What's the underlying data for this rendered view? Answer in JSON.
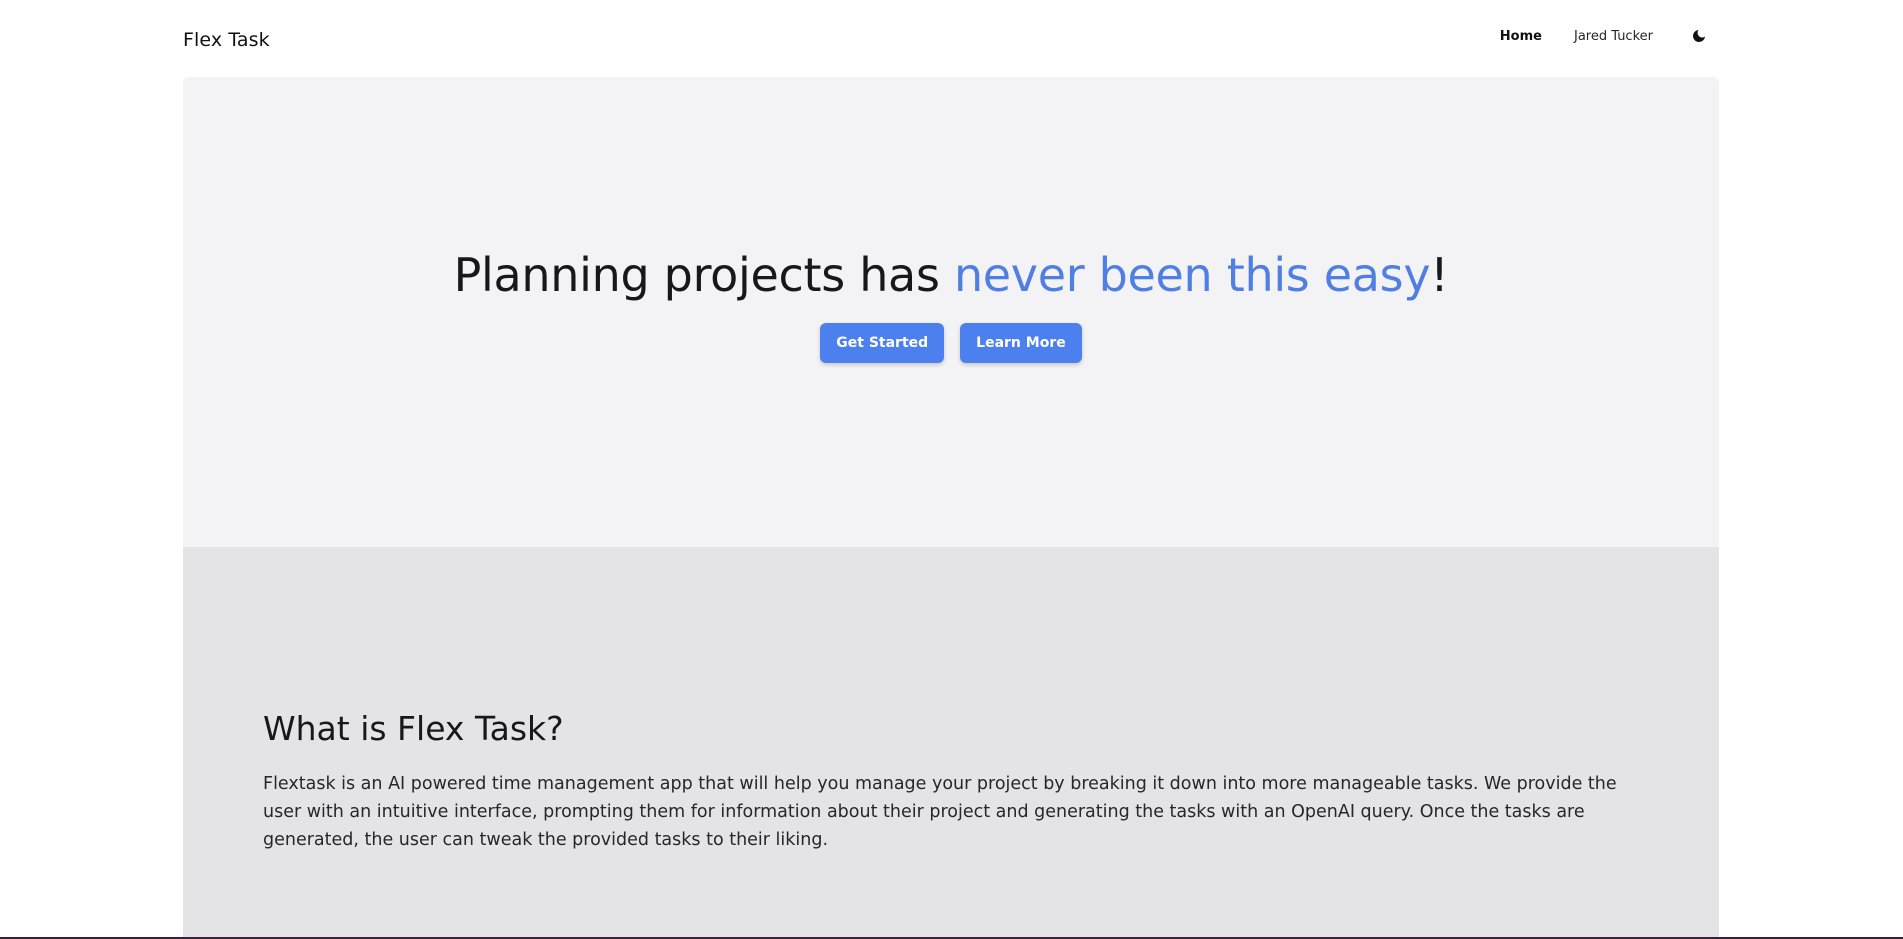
{
  "header": {
    "brand": "Flex Task",
    "nav": {
      "home": "Home",
      "user": "Jared Tucker"
    },
    "theme_icon": "moon-icon"
  },
  "hero": {
    "title_prefix": "Planning projects has ",
    "title_accent": "never been this easy",
    "title_suffix": "!",
    "primary_button": "Get Started",
    "secondary_button": "Learn More"
  },
  "about": {
    "title": "What is Flex Task?",
    "body": "Flextask is an AI powered time management app that will help you manage your project by breaking it down into more manageable tasks. We provide the user with an intuitive interface, prompting them for information about their project and generating the tasks with an OpenAI query. Once the tasks are generated, the user can tweak the provided tasks to their liking."
  },
  "colors": {
    "accent": "#4f7fe3",
    "button": "#4d80ef",
    "hero_bg": "#f3f3f5",
    "about_bg": "#e4e4e7"
  }
}
